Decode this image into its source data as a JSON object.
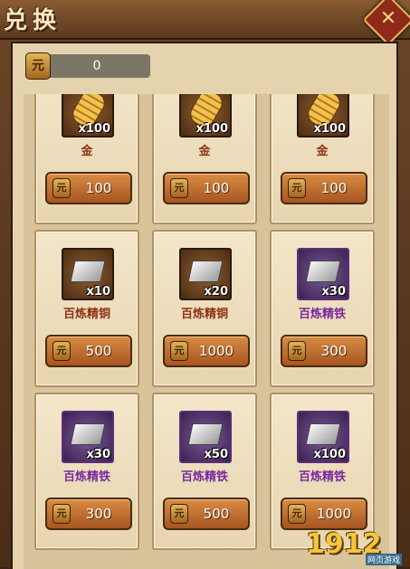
{
  "title": "兑换",
  "close": {
    "glyph": "✕"
  },
  "currency": {
    "icon": "coin-icon",
    "coin_char": "元",
    "amount": "0"
  },
  "rows": [
    [
      {
        "item": "gold",
        "icon": "gold-bar-icon",
        "qty": "x100",
        "name": "金",
        "color": "#8d3316",
        "price": "100"
      },
      {
        "item": "gold",
        "icon": "gold-bar-icon",
        "qty": "x100",
        "name": "金",
        "color": "#8d3316",
        "price": "100"
      },
      {
        "item": "gold",
        "icon": "gold-bar-icon",
        "qty": "x100",
        "name": "金",
        "color": "#8d3316",
        "price": "100"
      }
    ],
    [
      {
        "item": "copper",
        "icon": "ingot-icon",
        "qty": "x10",
        "name": "百炼精铜",
        "color": "#8d3316",
        "price": "500"
      },
      {
        "item": "copper",
        "icon": "ingot-icon",
        "qty": "x20",
        "name": "百炼精铜",
        "color": "#8d3316",
        "price": "1000"
      },
      {
        "item": "iron",
        "icon": "ingot-icon",
        "qty": "x30",
        "name": "百炼精铁",
        "color": "#7a2a9c",
        "price": "300"
      }
    ],
    [
      {
        "item": "iron",
        "icon": "ingot-icon",
        "qty": "x30",
        "name": "百炼精铁",
        "color": "#7a2a9c",
        "price": "300"
      },
      {
        "item": "iron",
        "icon": "ingot-icon",
        "qty": "x50",
        "name": "百炼精铁",
        "color": "#7a2a9c",
        "price": "500"
      },
      {
        "item": "iron",
        "icon": "ingot-icon",
        "qty": "x100",
        "name": "百炼精铁",
        "color": "#7a2a9c",
        "price": "1000"
      }
    ]
  ],
  "price_coin_char": "元",
  "watermark": {
    "brand": "1912",
    "sub": "网页游戏"
  }
}
